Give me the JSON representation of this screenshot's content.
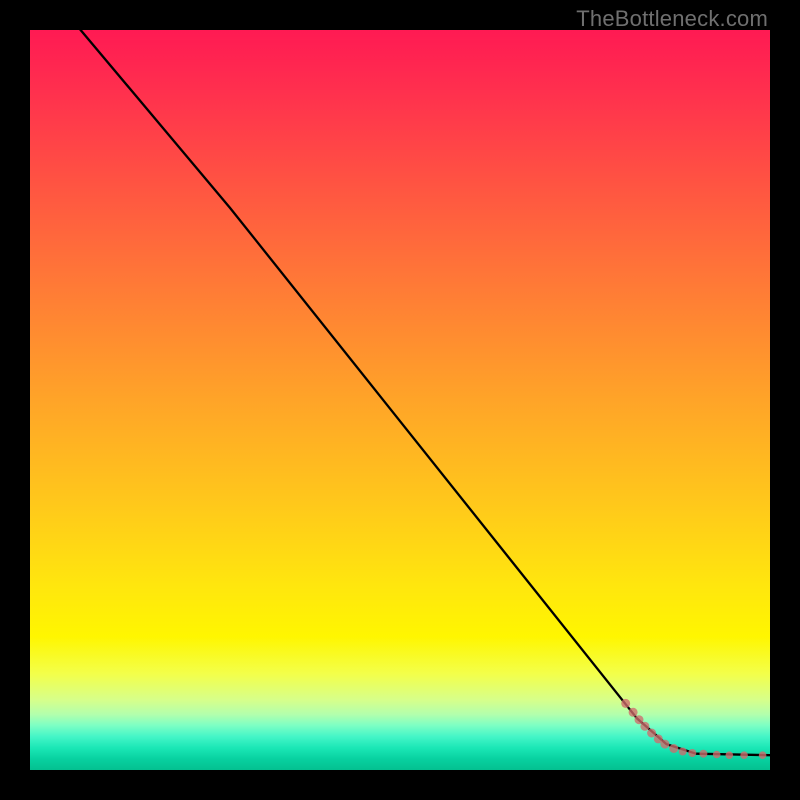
{
  "attribution": "TheBottleneck.com",
  "colors": {
    "dot": "#cf6b6b",
    "line": "#000000",
    "frame": "#000000"
  },
  "chart_data": {
    "type": "line",
    "title": "",
    "xlabel": "",
    "ylabel": "",
    "xlim": [
      0,
      100
    ],
    "ylim": [
      0,
      100
    ],
    "grid": false,
    "legend": false,
    "series": [
      {
        "name": "curve",
        "points": [
          {
            "x": 6,
            "y": 101
          },
          {
            "x": 27,
            "y": 76
          },
          {
            "x": 82,
            "y": 7
          },
          {
            "x": 86,
            "y": 3.5
          },
          {
            "x": 90,
            "y": 2.2
          },
          {
            "x": 100,
            "y": 2.0
          }
        ]
      }
    ],
    "dots": [
      {
        "x": 80.5,
        "y": 9.0,
        "r": 4.5
      },
      {
        "x": 81.5,
        "y": 7.8,
        "r": 4.5
      },
      {
        "x": 82.3,
        "y": 6.8,
        "r": 4.5
      },
      {
        "x": 83.1,
        "y": 5.9,
        "r": 4.5
      },
      {
        "x": 84.0,
        "y": 5.0,
        "r": 4.5
      },
      {
        "x": 84.9,
        "y": 4.2,
        "r": 4.5
      },
      {
        "x": 85.8,
        "y": 3.5,
        "r": 4.5
      },
      {
        "x": 87.0,
        "y": 2.9,
        "r": 4.5
      },
      {
        "x": 88.2,
        "y": 2.5,
        "r": 4.0
      },
      {
        "x": 89.5,
        "y": 2.3,
        "r": 4.0
      },
      {
        "x": 91.0,
        "y": 2.2,
        "r": 4.0
      },
      {
        "x": 92.8,
        "y": 2.1,
        "r": 3.8
      },
      {
        "x": 94.5,
        "y": 2.0,
        "r": 3.8
      },
      {
        "x": 96.5,
        "y": 2.0,
        "r": 3.8
      },
      {
        "x": 99.0,
        "y": 2.0,
        "r": 3.8
      }
    ]
  }
}
